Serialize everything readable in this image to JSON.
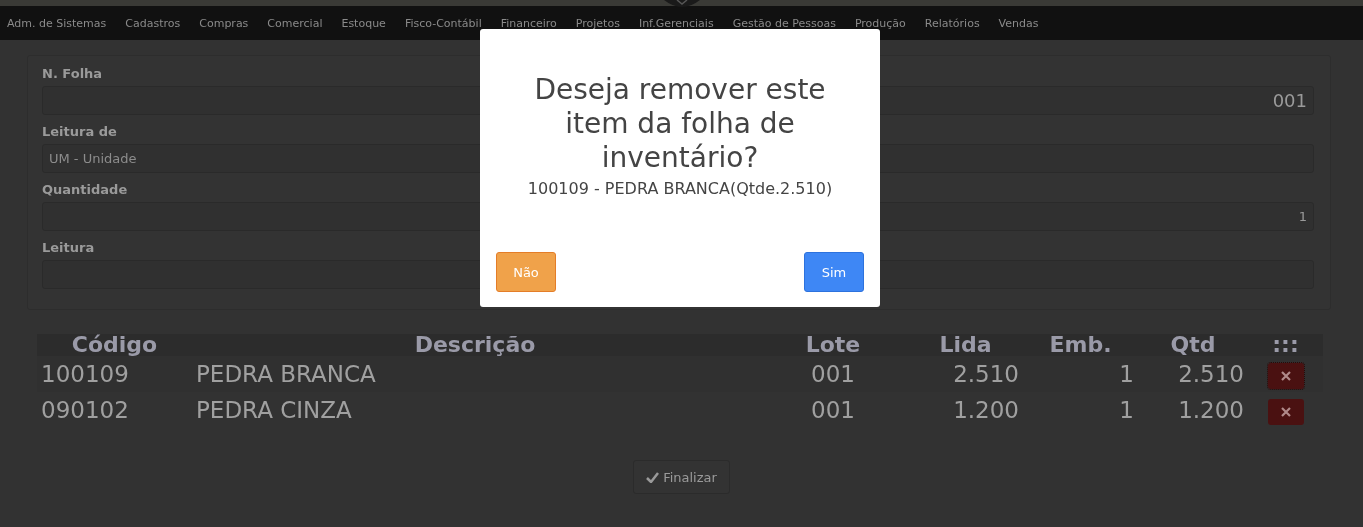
{
  "menu": [
    "Adm. de Sistemas",
    "Cadastros",
    "Compras",
    "Comercial",
    "Estoque",
    "Fisco-Contábil",
    "Financeiro",
    "Projetos",
    "Inf.Gerenciais",
    "Gestão de Pessoas",
    "Produção",
    "Relatórios",
    "Vendas"
  ],
  "form": {
    "fields": [
      {
        "label": "N. Folha",
        "value": "001"
      },
      {
        "label": "Leitura de",
        "placeholder": "UM - Unidade"
      },
      {
        "label": "Quantidade",
        "value": "1"
      },
      {
        "label": "Leitura"
      }
    ]
  },
  "table": {
    "columns": [
      "Código",
      "Descrição",
      "Lote",
      "Lida",
      "Emb.",
      "Qtd",
      ":::"
    ],
    "rows": [
      {
        "cells": [
          "100109",
          "PEDRA BRANCA",
          "001",
          "2.510",
          "1",
          "2.510"
        ],
        "selected": true
      },
      {
        "cells": [
          "090102",
          "PEDRA CINZA",
          "001",
          "1.200",
          "1",
          "1.200"
        ],
        "selected": false
      }
    ]
  },
  "finish_button": "Finalizar",
  "dialog": {
    "title": "Deseja remover este item da folha de inventário?",
    "message": "100109 - PEDRA BRANCA(Qtde.2.510)",
    "cancel": "Não",
    "confirm": "Sim"
  }
}
